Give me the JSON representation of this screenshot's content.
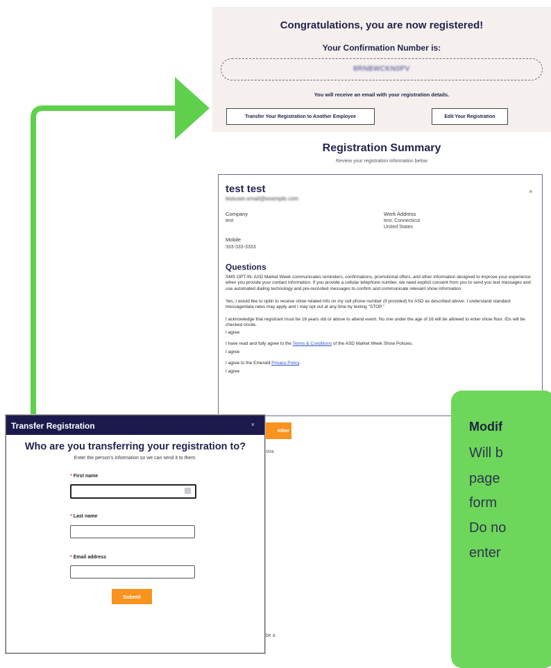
{
  "confirmation": {
    "congrats": "Congratulations, you are now registered!",
    "number_label": "Your Confirmation Number is:",
    "number": "8RNBWCKN0PV",
    "email_note": "You will receive an email with your registration details.",
    "transfer_button": "Transfer Your Registration to Another Employee",
    "edit_button": "Edit Your Registration"
  },
  "summary": {
    "title": "Registration Summary",
    "subtitle": "Review your registration information below",
    "name": "test test",
    "email": "testuser.email@example.com",
    "company_label": "Company",
    "company_value": "test",
    "work_address_label": "Work Address",
    "work_address_line1": "test, Connecticut",
    "work_address_line2": "United States",
    "mobile_label": "Mobile",
    "mobile_value": "333-333-3333",
    "questions_title": "Questions",
    "sms_text": "SMS OPT-IN: ASD Market Week communicates reminders, confirmations, promotional offers, and other information designed to improve your experience when you provide your contact information. If you provide a cellular telephone number, we need explicit consent from you to send you text messages and use automated dialing technology and pre-recorded messages to confirm and communicate relevant show information.",
    "sms_answer": "Yes, I would like to optin to receive show related info on my cell phone number (if provided) for ASD as described above. I understand standard message/data rates may apply and I may opt out at any time by texting \"STOP.\"",
    "age_text": "I acknowledge that registrant must be 16 years old or above to attend event. No one under the age of 16 will be allowed to enter show floor. IDs will be checked onsite.",
    "agree1": "I agree",
    "terms_pre": "I have read and fully agree to the ",
    "terms_link": "Terms & Conditions",
    "terms_post": " of the ASD Market Week Show Policies.",
    "agree2": "I agree",
    "privacy_pre": "I agree to the Emerald ",
    "privacy_link": "Privacy Policy",
    "privacy_post": ".",
    "agree3": "I agree",
    "peek_button": "mber"
  },
  "modal": {
    "title": "Transfer Registration",
    "close": "×",
    "question": "Who are you transferring your registration to?",
    "subtitle": "Enter the person's information so we can send it to them.",
    "first_name_label": "First name",
    "last_name_label": "Last name",
    "email_label": "Email address",
    "required_mark": "*",
    "submit": "Submit",
    "side_text_1": "stra",
    "side_text_2": "be a"
  },
  "callout": {
    "title": "Modif",
    "lines": [
      "Will b",
      "page",
      "form",
      "Do no",
      "enter"
    ]
  },
  "colors": {
    "green_arrow": "#5fd04c",
    "header_navy": "#1c1a4d",
    "accent_orange": "#f7931e",
    "panel_bg": "#f5f0ed"
  }
}
